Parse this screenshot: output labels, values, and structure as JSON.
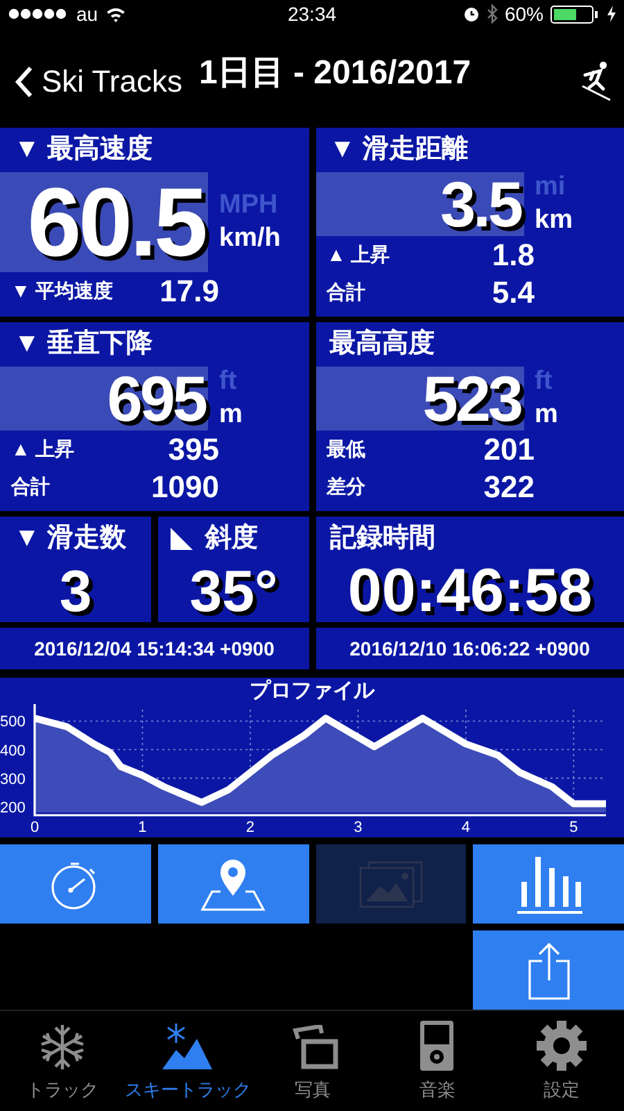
{
  "status_bar": {
    "carrier": "au",
    "time": "23:34",
    "battery": "60%"
  },
  "nav": {
    "back": "Ski Tracks",
    "title": "1日目 - 2016/2017"
  },
  "panels": [
    {
      "kind": "large",
      "title": "▼ 最高速度",
      "value": "60.5",
      "units": [
        {
          "label": "MPH",
          "selected": false
        },
        {
          "label": "km/h",
          "selected": true
        }
      ],
      "rows": [
        {
          "label": "▼ 平均速度",
          "value": "17.9"
        }
      ]
    },
    {
      "kind": "medium",
      "title": "▼ 滑走距離",
      "value": "3.5",
      "units": [
        {
          "label": "mi",
          "selected": false
        },
        {
          "label": "km",
          "selected": true
        }
      ],
      "rows": [
        {
          "label": "▲ 上昇",
          "value": "1.8"
        },
        {
          "label": "合計",
          "value": "5.4"
        }
      ]
    },
    {
      "kind": "medium",
      "title": "▼ 垂直下降",
      "value": "695",
      "units": [
        {
          "label": "ft",
          "selected": false
        },
        {
          "label": "m",
          "selected": true
        }
      ],
      "rows": [
        {
          "label": "▲ 上昇",
          "value": "395"
        },
        {
          "label": "合計",
          "value": "1090"
        }
      ]
    },
    {
      "kind": "medium",
      "title": "最高高度",
      "value": "523",
      "units": [
        {
          "label": "ft",
          "selected": false
        },
        {
          "label": "m",
          "selected": true
        }
      ],
      "rows": [
        {
          "label": "最低",
          "value": "201"
        },
        {
          "label": "差分",
          "value": "322"
        }
      ]
    }
  ],
  "counters": [
    {
      "kind": "text",
      "title": "▼ 滑走数",
      "value": "3"
    },
    {
      "kind": "slope",
      "title": "斜度",
      "value": "35°"
    },
    {
      "kind": "text",
      "title": "記録時間",
      "value": "00:46:58"
    }
  ],
  "dates": [
    "2016/12/04 15:14:34 +0900",
    "2016/12/10 16:06:22 +0900"
  ],
  "profile": {
    "chart_data": {
      "type": "area",
      "title": "プロファイル",
      "x": [
        0,
        0.3,
        0.55,
        0.7,
        0.8,
        1.0,
        1.2,
        1.55,
        1.8,
        2.2,
        2.5,
        2.7,
        3.15,
        3.6,
        4.0,
        4.3,
        4.5,
        4.8,
        5.0,
        5.3
      ],
      "grid": true,
      "series": [
        {
          "color": "#ffffff",
          "values": [
            510,
            480,
            420,
            390,
            340,
            310,
            270,
            215,
            260,
            380,
            450,
            510,
            410,
            510,
            420,
            380,
            320,
            270,
            210,
            210
          ]
        }
      ],
      "xlim": [
        0,
        5.3
      ],
      "ylim": [
        180,
        540
      ],
      "xticks": [
        0,
        1,
        2,
        3,
        4,
        5
      ],
      "yticks": [
        200,
        300,
        400,
        500
      ]
    }
  },
  "actions": [
    {
      "kind": "stopwatch",
      "disabled": false
    },
    {
      "kind": "map",
      "disabled": false
    },
    {
      "kind": "photos",
      "disabled": true
    },
    {
      "kind": "bars",
      "disabled": false
    }
  ],
  "share": {
    "kind": "share",
    "disabled": false
  },
  "tabs": [
    {
      "kind": "snowflake",
      "label": "トラック",
      "selected": false
    },
    {
      "kind": "ski",
      "label": "スキートラック",
      "selected": true
    },
    {
      "kind": "photos",
      "label": "写真",
      "selected": false
    },
    {
      "kind": "music",
      "label": "音楽",
      "selected": false
    },
    {
      "kind": "gear",
      "label": "設定",
      "selected": false
    }
  ]
}
